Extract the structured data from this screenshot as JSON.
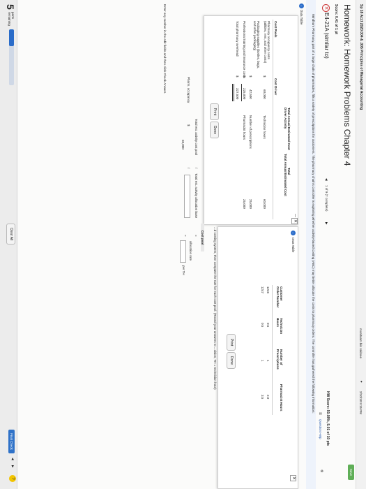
{
  "header": {
    "course": "Sp 18 Acct 2020.004 & .005 Principles of Managerial Accounting",
    "user": "moaltaam bin rokinee",
    "datetime": "2/10/18 9:15 PM",
    "save_label": "Save"
  },
  "title": "Homework: Homework Problems Chapter 4",
  "score": "Score: 0.41 of 1 pt",
  "pager": "1 of 9 (7 complete)",
  "hw_score": "HW Score: 50.08%, 5.01 of 10 pts",
  "question_help": "Question Help",
  "problem": "E4-21A (similar to)",
  "problem_text": "Windham Pharmacy, part of a large chain of pharmacies, fills a variety of prescriptions for customers. The pharmacy chain's controller is exploring whether activity-based costing (ABC) may better allocate the costs to pharmacy orders. The controller has gathered the following information:",
  "data_table_link": "Data Table",
  "left_table": {
    "title": "Data Table",
    "headers": {
      "cost_pools": "Cost Pools",
      "total_annual_cost": "Total Annual Estimated Cost",
      "cost_driver": "Cost Driver",
      "total_driver": "Total Annual Estimated Cost Driver Activity"
    },
    "rows": [
      {
        "pool": "Pharmacy occupancy costs (utilities, rent, and other costs)",
        "dollar": "$",
        "cost": "60,000",
        "driver": "Technician hours",
        "activity": "60,000"
      },
      {
        "pool": "Packaging supplies (bottles, bags, and other packaging)",
        "dollar": "",
        "cost": "42,500",
        "driver": "Number of prescriptions",
        "activity": "25,000"
      },
      {
        "pool": "Professional training and insurance costs",
        "dollar": "$",
        "cost": "225,000",
        "driver": "Pharmacist hours",
        "activity": "25,000"
      },
      {
        "pool": "Total pharmacy overhead",
        "dollar": "$",
        "cost": "327,500",
        "driver": "",
        "activity": ""
      }
    ],
    "dollar_packaging": "$",
    "print_label": "Print",
    "done_label": "Done"
  },
  "right_table": {
    "title": "Data Table",
    "headers": {
      "order": "Customer Order Number",
      "tech": "Technician Hours",
      "presc": "Number of Prescriptions",
      "pharm": "Pharmacist Hours"
    },
    "rows": [
      {
        "order": "1246",
        "tech": "0.5",
        "presc": "1",
        "pharm": "2.0"
      },
      {
        "order": "1247",
        "tech": "0.5",
        "presc": "1",
        "pharm": "3.5"
      }
    ],
    "print_label": "Print",
    "done_label": "Done"
  },
  "right_text": "...d costing system, then compute the rate for each cost pool. (Round your answers to ...cision, TH = technician hour)",
  "formula": {
    "header": "Cost pool",
    "col1": "Total est. activity cost pool",
    "slash1": "/",
    "col2": "Total est. activity allocation base",
    "eq": "=",
    "col3": "allocation rate",
    "row_label": "Pharm. occupancy",
    "dollar": "$",
    "value": "60,000",
    "slash2": "/",
    "eq2": "=",
    "unit": "per TH"
  },
  "instructions": "Enter any number in the edit fields and then click Check Answer.",
  "parts": {
    "count": "5",
    "label": "parts remaining",
    "progress": 0.3
  },
  "clear_all_label": "Clear All",
  "final_check_label": "Final Check",
  "colors": {
    "accent": "#2a6cc9",
    "save_green": "#5fae57",
    "final_check": "#2f72c8"
  }
}
